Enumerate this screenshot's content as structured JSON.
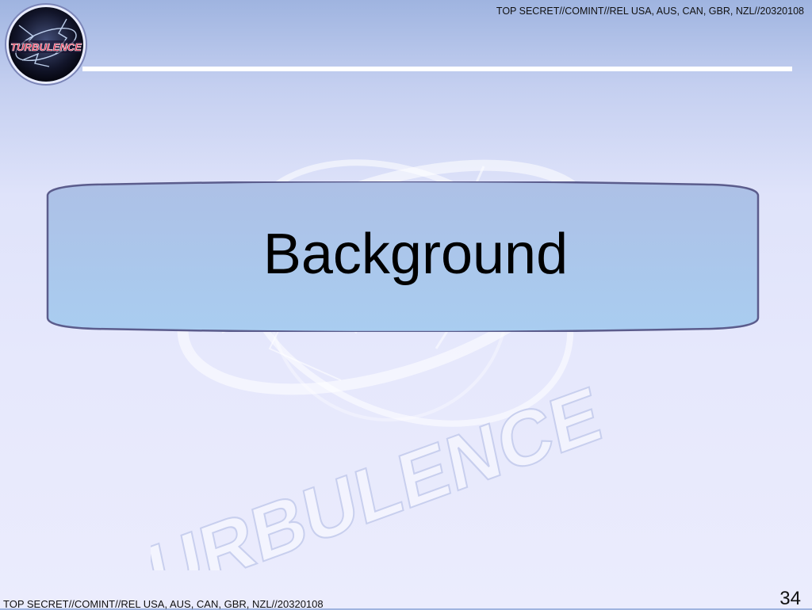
{
  "slide": {
    "classification_top": "TOP SECRET//COMINT//REL USA, AUS, CAN, GBR, NZL//20320108",
    "classification_bottom": "TOP SECRET//COMINT//REL USA, AUS, CAN, GBR, NZL//20320108",
    "title": "Background",
    "page_number": "34",
    "logo": {
      "icon": "turbulence-program-emblem",
      "text": "TURBULENCE"
    },
    "watermark": {
      "icon": "turbulence-watermark",
      "text": "TURBULENCE"
    }
  },
  "colors": {
    "title_box_top": "#adc0e6",
    "title_box_bottom": "#a9cdf0",
    "title_box_border": "#5b5c8c",
    "logo_text": "#e3264a",
    "header_rule": "#ffffff"
  }
}
